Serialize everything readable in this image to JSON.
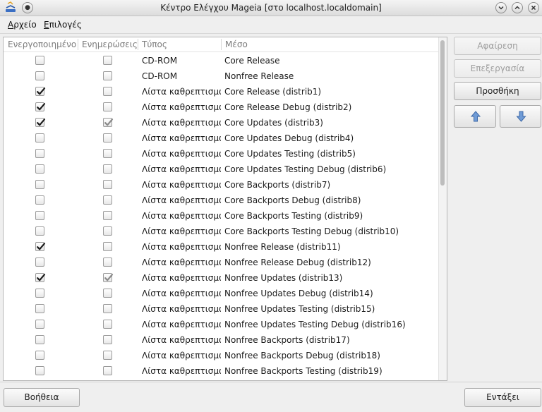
{
  "window": {
    "title": "Κέντρο Ελέγχου Mageia  [στο localhost.localdomain]"
  },
  "icons": {
    "app": "mageia-update-icon",
    "minimize": "chevron-down-icon",
    "maximize": "chevron-up-icon",
    "close": "close-icon",
    "up": "arrow-up-icon",
    "down": "arrow-down-icon"
  },
  "menu": {
    "file_prefix": "",
    "file_ul": "Α",
    "file_rest": "ρχείο",
    "options_prefix": "",
    "options_ul": "Ε",
    "options_rest": "πιλογές"
  },
  "table": {
    "headers": {
      "enabled": "Ενεργοποιημένο",
      "updates": "Ενημερώσεις",
      "type": "Τύπος",
      "medium": "Μέσο"
    },
    "rows": [
      {
        "enabled": false,
        "updates": false,
        "type": "CD-ROM",
        "medium": "Core Release"
      },
      {
        "enabled": false,
        "updates": false,
        "type": "CD-ROM",
        "medium": "Nonfree Release"
      },
      {
        "enabled": true,
        "updates": false,
        "type": "Λίστα καθρεπτισμών",
        "medium": "Core Release (distrib1)"
      },
      {
        "enabled": true,
        "updates": false,
        "type": "Λίστα καθρεπτισμών",
        "medium": "Core Release Debug (distrib2)"
      },
      {
        "enabled": true,
        "updates": true,
        "type": "Λίστα καθρεπτισμών",
        "medium": "Core Updates (distrib3)"
      },
      {
        "enabled": false,
        "updates": false,
        "type": "Λίστα καθρεπτισμών",
        "medium": "Core Updates Debug (distrib4)"
      },
      {
        "enabled": false,
        "updates": false,
        "type": "Λίστα καθρεπτισμών",
        "medium": "Core Updates Testing (distrib5)"
      },
      {
        "enabled": false,
        "updates": false,
        "type": "Λίστα καθρεπτισμών",
        "medium": "Core Updates Testing Debug (distrib6)"
      },
      {
        "enabled": false,
        "updates": false,
        "type": "Λίστα καθρεπτισμών",
        "medium": "Core Backports (distrib7)"
      },
      {
        "enabled": false,
        "updates": false,
        "type": "Λίστα καθρεπτισμών",
        "medium": "Core Backports Debug (distrib8)"
      },
      {
        "enabled": false,
        "updates": false,
        "type": "Λίστα καθρεπτισμών",
        "medium": "Core Backports Testing (distrib9)"
      },
      {
        "enabled": false,
        "updates": false,
        "type": "Λίστα καθρεπτισμών",
        "medium": "Core Backports Testing Debug (distrib10)"
      },
      {
        "enabled": true,
        "updates": false,
        "type": "Λίστα καθρεπτισμών",
        "medium": "Nonfree Release (distrib11)"
      },
      {
        "enabled": false,
        "updates": false,
        "type": "Λίστα καθρεπτισμών",
        "medium": "Nonfree Release Debug (distrib12)"
      },
      {
        "enabled": true,
        "updates": true,
        "type": "Λίστα καθρεπτισμών",
        "medium": "Nonfree Updates (distrib13)"
      },
      {
        "enabled": false,
        "updates": false,
        "type": "Λίστα καθρεπτισμών",
        "medium": "Nonfree Updates Debug (distrib14)"
      },
      {
        "enabled": false,
        "updates": false,
        "type": "Λίστα καθρεπτισμών",
        "medium": "Nonfree Updates Testing (distrib15)"
      },
      {
        "enabled": false,
        "updates": false,
        "type": "Λίστα καθρεπτισμών",
        "medium": "Nonfree Updates Testing Debug (distrib16)"
      },
      {
        "enabled": false,
        "updates": false,
        "type": "Λίστα καθρεπτισμών",
        "medium": "Nonfree Backports (distrib17)"
      },
      {
        "enabled": false,
        "updates": false,
        "type": "Λίστα καθρεπτισμών",
        "medium": "Nonfree Backports Debug (distrib18)"
      },
      {
        "enabled": false,
        "updates": false,
        "type": "Λίστα καθρεπτισμών",
        "medium": "Nonfree Backports Testing (distrib19)"
      }
    ]
  },
  "buttons": {
    "remove": "Αφαίρεση",
    "edit": "Επεξεργασία",
    "add": "Προσθήκη",
    "help": "Βοήθεια",
    "ok": "Εντάξει"
  },
  "colors": {
    "check_enabled": "#1c1c1c",
    "check_updates": "#8a8a8a"
  }
}
